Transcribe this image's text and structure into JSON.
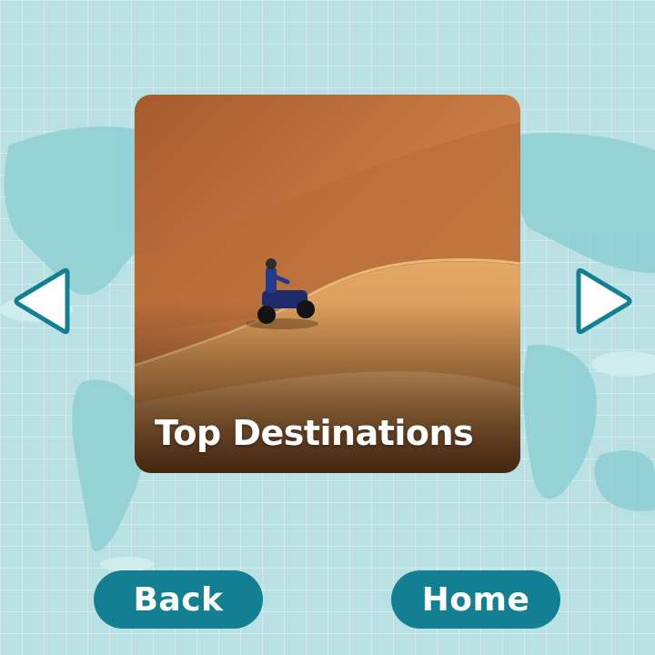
{
  "card": {
    "title": "Top Destinations",
    "image": "desert-dunes-quad-bike-photo"
  },
  "navigation": {
    "prev_icon": "triangle-left-icon",
    "next_icon": "triangle-right-icon"
  },
  "buttons": {
    "back_label": "Back",
    "home_label": "Home"
  },
  "colors": {
    "background": "#b9e0e2",
    "map_land": "#8ecfd4",
    "button": "#127f93",
    "arrow_stroke": "#127f93",
    "arrow_fill": "#ffffff"
  }
}
